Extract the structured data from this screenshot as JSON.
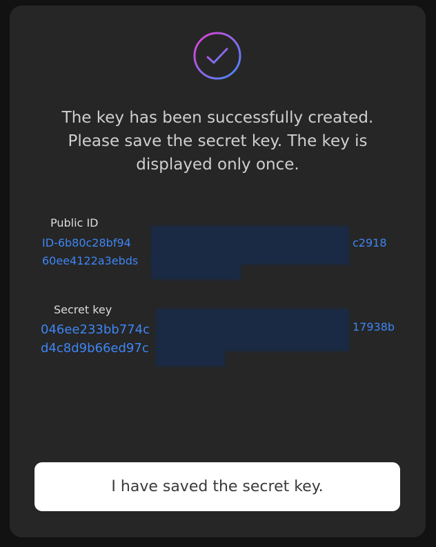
{
  "dialog": {
    "message_lines": [
      "The key has been successfully created.",
      "Please save the secret key. The key is",
      "displayed only once."
    ],
    "icon": "check-circle-icon",
    "accent_gradient": [
      "#e23fd0",
      "#3f8cff"
    ]
  },
  "public_id": {
    "label": "Public ID",
    "value_lines": [
      "ID-6b80c28bf94",
      "60ee4122a3ebds"
    ],
    "value_tail": "c2918"
  },
  "secret_key": {
    "label": "Secret key",
    "value_lines": [
      "046ee233bb774c",
      "d4c8d9b66ed97c"
    ],
    "value_tail": "17938b"
  },
  "actions": {
    "confirm_label": "I have saved the secret key."
  },
  "colors": {
    "background": "#262626",
    "link": "#3e86f5",
    "button": "#ffffff"
  }
}
